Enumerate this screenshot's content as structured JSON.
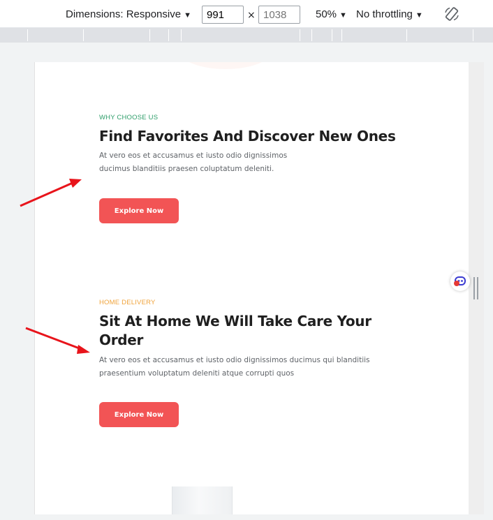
{
  "toolbar": {
    "dimensions_label": "Dimensions: Responsive",
    "width_value": "991",
    "height_placeholder": "1038",
    "times_symbol": "×",
    "zoom_label": "50%",
    "throttling_label": "No throttling",
    "caret": "▼"
  },
  "sections": [
    {
      "eyebrow": "WHY CHOOSE US",
      "eyebrow_color": "#2e9e6a",
      "heading": "Find Favorites And Discover New Ones",
      "paragraph_lines": [
        "At vero eos et accusamus et iusto odio dignissimos",
        "ducimus blanditiis praesen coluptatum deleniti."
      ],
      "button_label": "Explore Now"
    },
    {
      "eyebrow": "HOME DELIVERY",
      "eyebrow_color": "#f0a33a",
      "heading_lines": [
        "Sit At Home We Will Take Care Your",
        "Order"
      ],
      "paragraph_lines": [
        "At vero eos et accusamus et iusto odio dignissimos ducimus qui blanditiis",
        "praesentium voluptatum deleniti atque corrupti quos"
      ],
      "button_label": "Explore Now"
    }
  ],
  "widget": {
    "icon": "chat-bot-icon",
    "badge": "1"
  },
  "colors": {
    "button": "#f25455",
    "arrow": "#e8141b"
  }
}
